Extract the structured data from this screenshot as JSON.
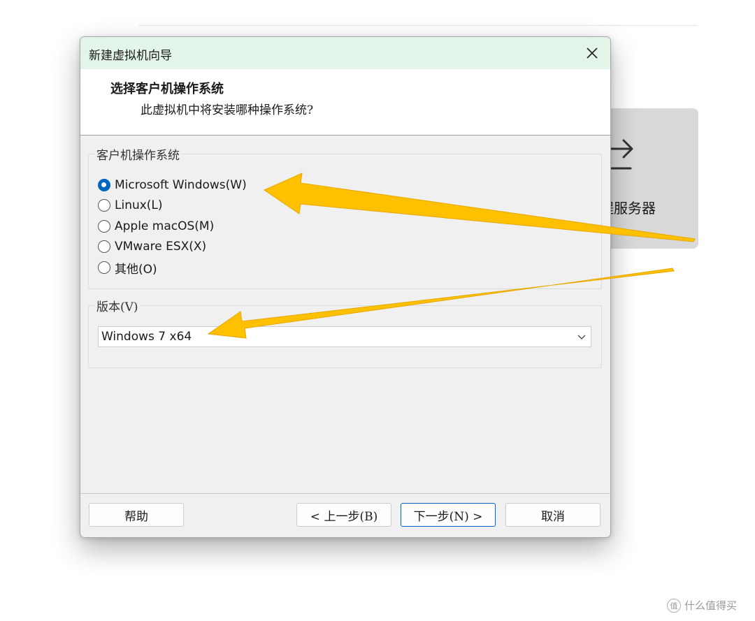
{
  "background": {
    "card_label": "程服务器"
  },
  "dialog": {
    "title": "新建虚拟机向导",
    "header": {
      "title": "选择客户机操作系统",
      "subtitle": "此虚拟机中将安装哪种操作系统?"
    },
    "os_group": {
      "legend": "客户机操作系统",
      "options": [
        {
          "label": "Microsoft Windows(W)",
          "checked": true
        },
        {
          "label": "Linux(L)",
          "checked": false
        },
        {
          "label": "Apple macOS(M)",
          "checked": false
        },
        {
          "label": "VMware ESX(X)",
          "checked": false
        },
        {
          "label": "其他(O)",
          "checked": false
        }
      ]
    },
    "version_group": {
      "legend": "版本(V)",
      "selected": "Windows 7 x64"
    },
    "buttons": {
      "help": "帮助",
      "back": "< 上一步(B)",
      "next": "下一步(N) >",
      "cancel": "取消"
    }
  },
  "annotation_color": "#ffc000",
  "accent_color": "#0067c0",
  "watermark": {
    "text": "什么值得买"
  }
}
